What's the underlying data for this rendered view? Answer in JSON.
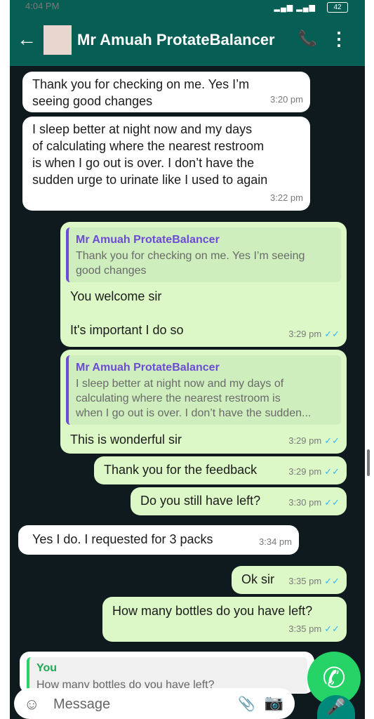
{
  "status": {
    "time": "4:04 PM",
    "battery": "42"
  },
  "header": {
    "contact": "Mr Amuah ProtateBalancer"
  },
  "messages": [
    {
      "dir": "in",
      "text_lines": [
        "Thank you for checking on me. Yes I’m",
        "seeing good changes"
      ],
      "time": "3:20 pm"
    },
    {
      "dir": "in",
      "text_lines": [
        "I sleep better at night now and my days",
        "of calculating where the nearest restroom",
        "is when I go out is over. I don’t have the",
        "sudden urge to urinate like I used to again"
      ],
      "time": "3:22 pm"
    },
    {
      "dir": "out",
      "quote_name": "Mr Amuah ProtateBalancer",
      "quote_lines": [
        "Thank you for checking on me. Yes I’m seeing",
        "good changes"
      ],
      "text_lines": [
        "You welcome sir",
        "",
        "It's important I do so"
      ],
      "time": "3:29 pm",
      "ticks": "✓✓"
    },
    {
      "dir": "out",
      "quote_name": "Mr Amuah ProtateBalancer",
      "quote_lines": [
        "I sleep better at night now and my days of",
        "calculating where the nearest restroom is",
        "when I go out is over. I don’t have the sudden..."
      ],
      "text_lines": [
        "This is wonderful sir"
      ],
      "time": "3:29 pm",
      "ticks": "✓✓"
    },
    {
      "dir": "out",
      "text_lines": [
        "Thank you for the feedback"
      ],
      "time": "3:29 pm",
      "ticks": "✓✓"
    },
    {
      "dir": "out",
      "text_lines": [
        "Do you still have left?"
      ],
      "time": "3:30 pm",
      "ticks": "✓✓"
    },
    {
      "dir": "in",
      "text_lines": [
        "Yes I do. I requested for 3 packs"
      ],
      "time": "3:34 pm"
    },
    {
      "dir": "out",
      "text_lines": [
        "Ok sir"
      ],
      "time": "3:35 pm",
      "ticks": "✓✓"
    },
    {
      "dir": "out",
      "text_lines": [
        "How many bottles do you have left?"
      ],
      "time": "3:35 pm",
      "ticks": "✓✓"
    }
  ],
  "partial_reply": {
    "name": "You",
    "text": "How many bottles do you have left?"
  },
  "input": {
    "placeholder": "Message"
  },
  "colors": {
    "bar": "#075e54",
    "outgoing": "#dcf8c6",
    "accent": "#25d366"
  }
}
